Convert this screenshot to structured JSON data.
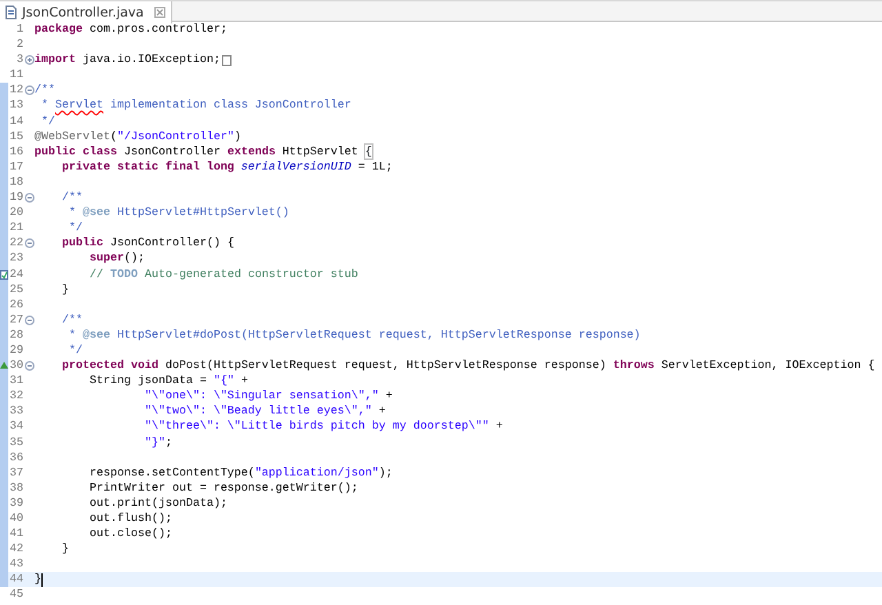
{
  "tabs": [
    {
      "title": "JsonController.java",
      "selected": true
    }
  ],
  "lines": [
    {
      "number": "1",
      "changed": false,
      "current": false,
      "segments": [
        {
          "kind": "kw",
          "text": "package"
        },
        {
          "kind": "plain",
          "text": " com.pros.controller;"
        }
      ]
    },
    {
      "number": "2",
      "changed": false,
      "current": false
    },
    {
      "number": "3",
      "changed": false,
      "current": false,
      "collapsed": true,
      "folded_box": true,
      "segments": [
        {
          "kind": "kw",
          "text": "import"
        },
        {
          "kind": "plain",
          "text": " java.io.IOException;"
        }
      ]
    },
    {
      "number": "11",
      "changed": false,
      "current": false
    },
    {
      "number": "12",
      "changed": true,
      "current": false,
      "collapsed": false,
      "segments": [
        {
          "kind": "doc",
          "text": "/**"
        }
      ]
    },
    {
      "number": "13",
      "changed": true,
      "current": false,
      "segments": [
        {
          "kind": "doc",
          "text": " * "
        },
        {
          "kind": "misspelled",
          "text": "Servlet"
        },
        {
          "kind": "doc",
          "text": " implementation class JsonController"
        }
      ]
    },
    {
      "number": "14",
      "changed": true,
      "current": false,
      "segments": [
        {
          "kind": "doc",
          "text": " */"
        }
      ]
    },
    {
      "number": "15",
      "changed": true,
      "current": false,
      "segments": [
        {
          "kind": "annot",
          "text": "@WebServlet"
        },
        {
          "kind": "plain",
          "text": "("
        },
        {
          "kind": "str",
          "text": "\"/JsonController\""
        },
        {
          "kind": "plain",
          "text": ")"
        }
      ]
    },
    {
      "number": "16",
      "changed": true,
      "current": false,
      "segments": [
        {
          "kind": "kw",
          "text": "public class"
        },
        {
          "kind": "plain",
          "text": " JsonController "
        },
        {
          "kind": "kw",
          "text": "extends"
        },
        {
          "kind": "plain",
          "text": " HttpServlet "
        },
        {
          "kind": "bracket",
          "text": "{"
        }
      ]
    },
    {
      "number": "17",
      "changed": true,
      "current": false,
      "segments": [
        {
          "kind": "kw",
          "text": "    private static final long"
        },
        {
          "kind": "field",
          "text": " serialVersionUID"
        },
        {
          "kind": "plain",
          "text": " = 1L;"
        }
      ]
    },
    {
      "number": "18",
      "changed": true,
      "current": false
    },
    {
      "number": "19",
      "changed": true,
      "current": false,
      "collapsed": false,
      "segments": [
        {
          "kind": "doc",
          "text": "    /**"
        }
      ]
    },
    {
      "number": "20",
      "changed": true,
      "current": false,
      "segments": [
        {
          "kind": "doc",
          "text": "     * "
        },
        {
          "kind": "doctag",
          "text": "@see"
        },
        {
          "kind": "doc",
          "text": " HttpServlet#HttpServlet()"
        }
      ]
    },
    {
      "number": "21",
      "changed": true,
      "current": false,
      "segments": [
        {
          "kind": "doc",
          "text": "     */"
        }
      ]
    },
    {
      "number": "22",
      "changed": true,
      "current": false,
      "collapsed": false,
      "segments": [
        {
          "kind": "kw",
          "text": "    public"
        },
        {
          "kind": "plain",
          "text": " JsonController() {"
        }
      ]
    },
    {
      "number": "23",
      "changed": true,
      "current": false,
      "segments": [
        {
          "kind": "kw",
          "text": "        super"
        },
        {
          "kind": "plain",
          "text": "();"
        }
      ]
    },
    {
      "number": "24",
      "changed": true,
      "current": false,
      "task": true,
      "segments": [
        {
          "kind": "comment",
          "text": "        // "
        },
        {
          "kind": "task",
          "text": "TODO"
        },
        {
          "kind": "comment",
          "text": " Auto-generated constructor stub"
        }
      ]
    },
    {
      "number": "25",
      "changed": true,
      "current": false,
      "segments": [
        {
          "kind": "plain",
          "text": "    }"
        }
      ]
    },
    {
      "number": "26",
      "changed": true,
      "current": false
    },
    {
      "number": "27",
      "changed": true,
      "current": false,
      "collapsed": false,
      "segments": [
        {
          "kind": "doc",
          "text": "    /**"
        }
      ]
    },
    {
      "number": "28",
      "changed": true,
      "current": false,
      "segments": [
        {
          "kind": "doc",
          "text": "     * "
        },
        {
          "kind": "doctag",
          "text": "@see"
        },
        {
          "kind": "doc",
          "text": " HttpServlet#doPost(HttpServletRequest request, HttpServletResponse response)"
        }
      ]
    },
    {
      "number": "29",
      "changed": true,
      "current": false,
      "segments": [
        {
          "kind": "doc",
          "text": "     */"
        }
      ]
    },
    {
      "number": "30",
      "changed": true,
      "current": false,
      "collapsed": false,
      "override": true,
      "segments": [
        {
          "kind": "kw",
          "text": "    protected void"
        },
        {
          "kind": "plain",
          "text": " doPost(HttpServletRequest request, HttpServletResponse response) "
        },
        {
          "kind": "kw",
          "text": "throws"
        },
        {
          "kind": "plain",
          "text": " ServletException, IOException {"
        }
      ]
    },
    {
      "number": "31",
      "changed": true,
      "current": false,
      "segments": [
        {
          "kind": "plain",
          "text": "        String jsonData = "
        },
        {
          "kind": "str",
          "text": "\"{\""
        },
        {
          "kind": "plain",
          "text": " +"
        }
      ]
    },
    {
      "number": "32",
      "changed": true,
      "current": false,
      "segments": [
        {
          "kind": "str",
          "text": "                \"\\\"one\\\": \\\"Singular sensation\\\",\""
        },
        {
          "kind": "plain",
          "text": " +"
        }
      ]
    },
    {
      "number": "33",
      "changed": true,
      "current": false,
      "segments": [
        {
          "kind": "str",
          "text": "                \"\\\"two\\\": \\\"Beady little eyes\\\",\""
        },
        {
          "kind": "plain",
          "text": " +"
        }
      ]
    },
    {
      "number": "34",
      "changed": true,
      "current": false,
      "segments": [
        {
          "kind": "str",
          "text": "                \"\\\"three\\\": \\\"Little birds pitch by my doorstep\\\"\""
        },
        {
          "kind": "plain",
          "text": " +"
        }
      ]
    },
    {
      "number": "35",
      "changed": true,
      "current": false,
      "segments": [
        {
          "kind": "str",
          "text": "                \"}\""
        },
        {
          "kind": "plain",
          "text": ";"
        }
      ]
    },
    {
      "number": "36",
      "changed": true,
      "current": false
    },
    {
      "number": "37",
      "changed": true,
      "current": false,
      "segments": [
        {
          "kind": "plain",
          "text": "        response.setContentType("
        },
        {
          "kind": "str",
          "text": "\"application/json\""
        },
        {
          "kind": "plain",
          "text": ");"
        }
      ]
    },
    {
      "number": "38",
      "changed": true,
      "current": false,
      "segments": [
        {
          "kind": "plain",
          "text": "        PrintWriter out = response.getWriter();"
        }
      ]
    },
    {
      "number": "39",
      "changed": true,
      "current": false,
      "segments": [
        {
          "kind": "plain",
          "text": "        out.print(jsonData);"
        }
      ]
    },
    {
      "number": "40",
      "changed": true,
      "current": false,
      "segments": [
        {
          "kind": "plain",
          "text": "        out.flush();"
        }
      ]
    },
    {
      "number": "41",
      "changed": true,
      "current": false,
      "segments": [
        {
          "kind": "plain",
          "text": "        out.close();"
        }
      ]
    },
    {
      "number": "42",
      "changed": true,
      "current": false,
      "segments": [
        {
          "kind": "plain",
          "text": "    }"
        }
      ]
    },
    {
      "number": "43",
      "changed": true,
      "current": false
    },
    {
      "number": "44",
      "changed": true,
      "current": true,
      "segments": [
        {
          "kind": "plain",
          "text": "}"
        }
      ]
    },
    {
      "number": "45",
      "changed": false,
      "current": false
    }
  ]
}
